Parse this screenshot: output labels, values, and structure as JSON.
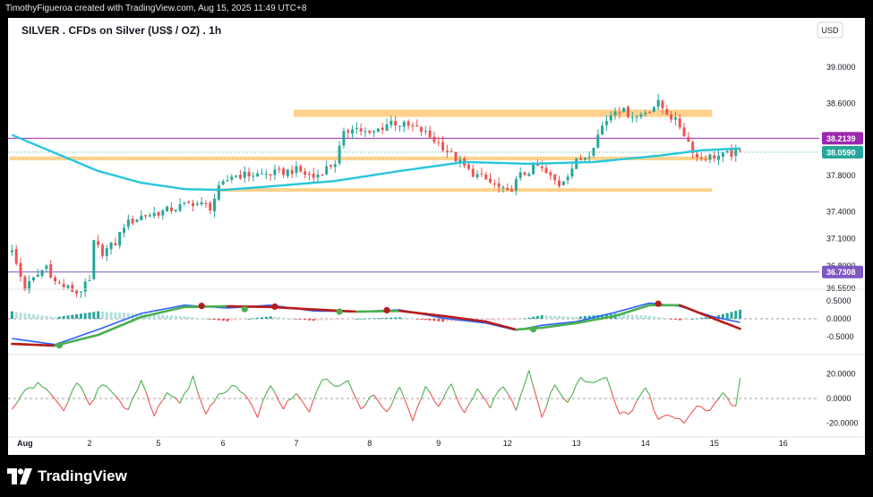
{
  "header": {
    "credit": "TimothyFigueroa created with TradingView.com, Aug 15, 2025 11:49 UTC+8",
    "title": "SILVER . CFDs on Silver (US$ / OZ) . 1h",
    "currency": "USD"
  },
  "footer": {
    "brand": "TradingView",
    "logo_icon": "tradingview-logo-icon"
  },
  "colors": {
    "up": "#26a69a",
    "down": "#ef5350",
    "ma": "#26c6da",
    "zone": "#ffcc80",
    "resistance_line": "#9c27b0",
    "support_line": "#7e57c2",
    "macd_fast": "#2962ff",
    "macd_slow": "#b71c1c",
    "osc_up": "#4caf50",
    "osc_down": "#ef5350"
  },
  "chart_data": {
    "type": "candlestick",
    "title": "SILVER . CFDs on Silver (US$ / OZ) . 1h",
    "currency": "USD",
    "x_ticks": [
      "Aug",
      "2",
      "5",
      "6",
      "7",
      "8",
      "9",
      "12",
      "13",
      "14",
      "15",
      "16"
    ],
    "price_axis": {
      "ticks": [
        "39.0000",
        "38.6000",
        "37.8000",
        "37.4000",
        "37.1000",
        "36.5500"
      ],
      "partially_hidden_tick": "36.8000",
      "ylim": [
        36.45,
        39.25
      ]
    },
    "price_labels": [
      {
        "value": 38.2139,
        "label": "38.2139",
        "color": "#9c27b0"
      },
      {
        "value": 38.059,
        "label": "38.0590",
        "color": "#26a69a"
      },
      {
        "value": 36.7308,
        "label": "36.7308",
        "color": "#7e57c2"
      }
    ],
    "horizontal_lines": [
      {
        "value": 38.2139,
        "color": "#9c27b0"
      },
      {
        "value": 36.7308,
        "color": "#7e57c2"
      }
    ],
    "zones": [
      {
        "value": 38.49,
        "from": "Aug 7",
        "to": "Aug 15",
        "color": "#ffcc80"
      },
      {
        "value": 37.99,
        "from": "Aug 1",
        "to": "Aug 15",
        "color": "#ffcc80"
      },
      {
        "value": 37.64,
        "from": "Aug 6",
        "to": "Aug 15",
        "color": "#ffcc80"
      }
    ],
    "price_anchors": [
      [
        0,
        36.95
      ],
      [
        3,
        36.55
      ],
      [
        8,
        36.8
      ],
      [
        10,
        36.62
      ],
      [
        13,
        36.55
      ],
      [
        15,
        36.5
      ],
      [
        18,
        36.62
      ],
      [
        19,
        37.05
      ],
      [
        21,
        36.95
      ],
      [
        24,
        37.05
      ],
      [
        26,
        37.25
      ],
      [
        30,
        37.35
      ],
      [
        35,
        37.4
      ],
      [
        42,
        37.5
      ],
      [
        46,
        37.45
      ],
      [
        48,
        37.65
      ],
      [
        51,
        37.8
      ],
      [
        60,
        37.82
      ],
      [
        66,
        37.86
      ],
      [
        70,
        37.78
      ],
      [
        75,
        37.95
      ],
      [
        77,
        38.25
      ],
      [
        79,
        38.35
      ],
      [
        83,
        38.25
      ],
      [
        88,
        38.4
      ],
      [
        95,
        38.3
      ],
      [
        100,
        38.12
      ],
      [
        106,
        37.85
      ],
      [
        110,
        37.75
      ],
      [
        115,
        37.6
      ],
      [
        118,
        37.8
      ],
      [
        122,
        37.9
      ],
      [
        127,
        37.7
      ],
      [
        131,
        37.95
      ],
      [
        134,
        38.05
      ],
      [
        137,
        38.35
      ],
      [
        140,
        38.55
      ],
      [
        145,
        38.45
      ],
      [
        150,
        38.6
      ],
      [
        155,
        38.35
      ],
      [
        159,
        38.0
      ],
      [
        165,
        38.02
      ],
      [
        169,
        38.06
      ]
    ],
    "ma_line": [
      [
        0,
        38.25
      ],
      [
        10,
        38.05
      ],
      [
        20,
        37.85
      ],
      [
        30,
        37.72
      ],
      [
        40,
        37.65
      ],
      [
        49,
        37.64
      ],
      [
        60,
        37.68
      ],
      [
        75,
        37.74
      ],
      [
        90,
        37.85
      ],
      [
        105,
        37.95
      ],
      [
        120,
        37.93
      ],
      [
        135,
        37.95
      ],
      [
        150,
        38.02
      ],
      [
        160,
        38.08
      ],
      [
        169,
        38.1
      ]
    ],
    "macd": {
      "ticks": [
        "0.5000",
        "0.0000",
        "-0.5000"
      ],
      "ylim": [
        -0.85,
        0.75
      ],
      "fast_line": [
        [
          0,
          -0.55
        ],
        [
          10,
          -0.72
        ],
        [
          20,
          -0.3
        ],
        [
          30,
          0.15
        ],
        [
          40,
          0.38
        ],
        [
          50,
          0.3
        ],
        [
          60,
          0.38
        ],
        [
          70,
          0.22
        ],
        [
          80,
          0.2
        ],
        [
          90,
          0.25
        ],
        [
          100,
          0.02
        ],
        [
          110,
          -0.12
        ],
        [
          117,
          -0.32
        ],
        [
          123,
          -0.18
        ],
        [
          131,
          -0.08
        ],
        [
          140,
          0.18
        ],
        [
          148,
          0.44
        ],
        [
          155,
          0.35
        ],
        [
          163,
          0.05
        ],
        [
          169,
          -0.1
        ]
      ],
      "slow_line": [
        [
          0,
          -0.7
        ],
        [
          10,
          -0.75
        ],
        [
          20,
          -0.45
        ],
        [
          30,
          0.05
        ],
        [
          40,
          0.33
        ],
        [
          50,
          0.35
        ],
        [
          60,
          0.33
        ],
        [
          70,
          0.26
        ],
        [
          80,
          0.2
        ],
        [
          90,
          0.22
        ],
        [
          100,
          0.08
        ],
        [
          110,
          -0.08
        ],
        [
          117,
          -0.3
        ],
        [
          123,
          -0.25
        ],
        [
          131,
          -0.12
        ],
        [
          140,
          0.08
        ],
        [
          148,
          0.38
        ],
        [
          155,
          0.38
        ],
        [
          163,
          0.0
        ],
        [
          169,
          -0.28
        ]
      ],
      "crossovers": [
        {
          "at": 11,
          "value": -0.74,
          "type": "bullish"
        },
        {
          "at": 44,
          "value": 0.36,
          "type": "bearish"
        },
        {
          "at": 54,
          "value": 0.27,
          "type": "bullish"
        },
        {
          "at": 61,
          "value": 0.34,
          "type": "bearish"
        },
        {
          "at": 76,
          "value": 0.2,
          "type": "bullish"
        },
        {
          "at": 87,
          "value": 0.24,
          "type": "bearish"
        },
        {
          "at": 121,
          "value": -0.29,
          "type": "bullish"
        },
        {
          "at": 150,
          "value": 0.42,
          "type": "bearish"
        }
      ]
    },
    "oscillator": {
      "ticks": [
        "20.0000",
        "0.0000",
        "-20.0000"
      ],
      "ylim": [
        -27,
        27
      ],
      "anchors": [
        [
          0,
          -8
        ],
        [
          3,
          5
        ],
        [
          6,
          12
        ],
        [
          9,
          3
        ],
        [
          12,
          -10
        ],
        [
          15,
          14
        ],
        [
          18,
          -5
        ],
        [
          21,
          12
        ],
        [
          24,
          2
        ],
        [
          27,
          -10
        ],
        [
          30,
          15
        ],
        [
          33,
          -14
        ],
        [
          36,
          6
        ],
        [
          39,
          -5
        ],
        [
          42,
          17
        ],
        [
          45,
          -12
        ],
        [
          48,
          3
        ],
        [
          51,
          10
        ],
        [
          54,
          4
        ],
        [
          57,
          -15
        ],
        [
          60,
          12
        ],
        [
          63,
          -8
        ],
        [
          66,
          5
        ],
        [
          69,
          -10
        ],
        [
          72,
          16
        ],
        [
          75,
          10
        ],
        [
          78,
          15
        ],
        [
          81,
          -9
        ],
        [
          84,
          3
        ],
        [
          87,
          -12
        ],
        [
          90,
          10
        ],
        [
          93,
          -18
        ],
        [
          96,
          9
        ],
        [
          99,
          -8
        ],
        [
          102,
          12
        ],
        [
          105,
          -13
        ],
        [
          108,
          6
        ],
        [
          111,
          -6
        ],
        [
          114,
          10
        ],
        [
          117,
          -8
        ],
        [
          120,
          24
        ],
        [
          123,
          -14
        ],
        [
          126,
          12
        ],
        [
          129,
          -4
        ],
        [
          132,
          18
        ],
        [
          135,
          11
        ],
        [
          138,
          18
        ],
        [
          141,
          -14
        ],
        [
          144,
          -10
        ],
        [
          147,
          10
        ],
        [
          150,
          -17
        ],
        [
          153,
          -13
        ],
        [
          156,
          -20
        ],
        [
          159,
          -6
        ],
        [
          162,
          -10
        ],
        [
          165,
          5
        ],
        [
          168,
          -8
        ],
        [
          169,
          16
        ]
      ]
    }
  }
}
